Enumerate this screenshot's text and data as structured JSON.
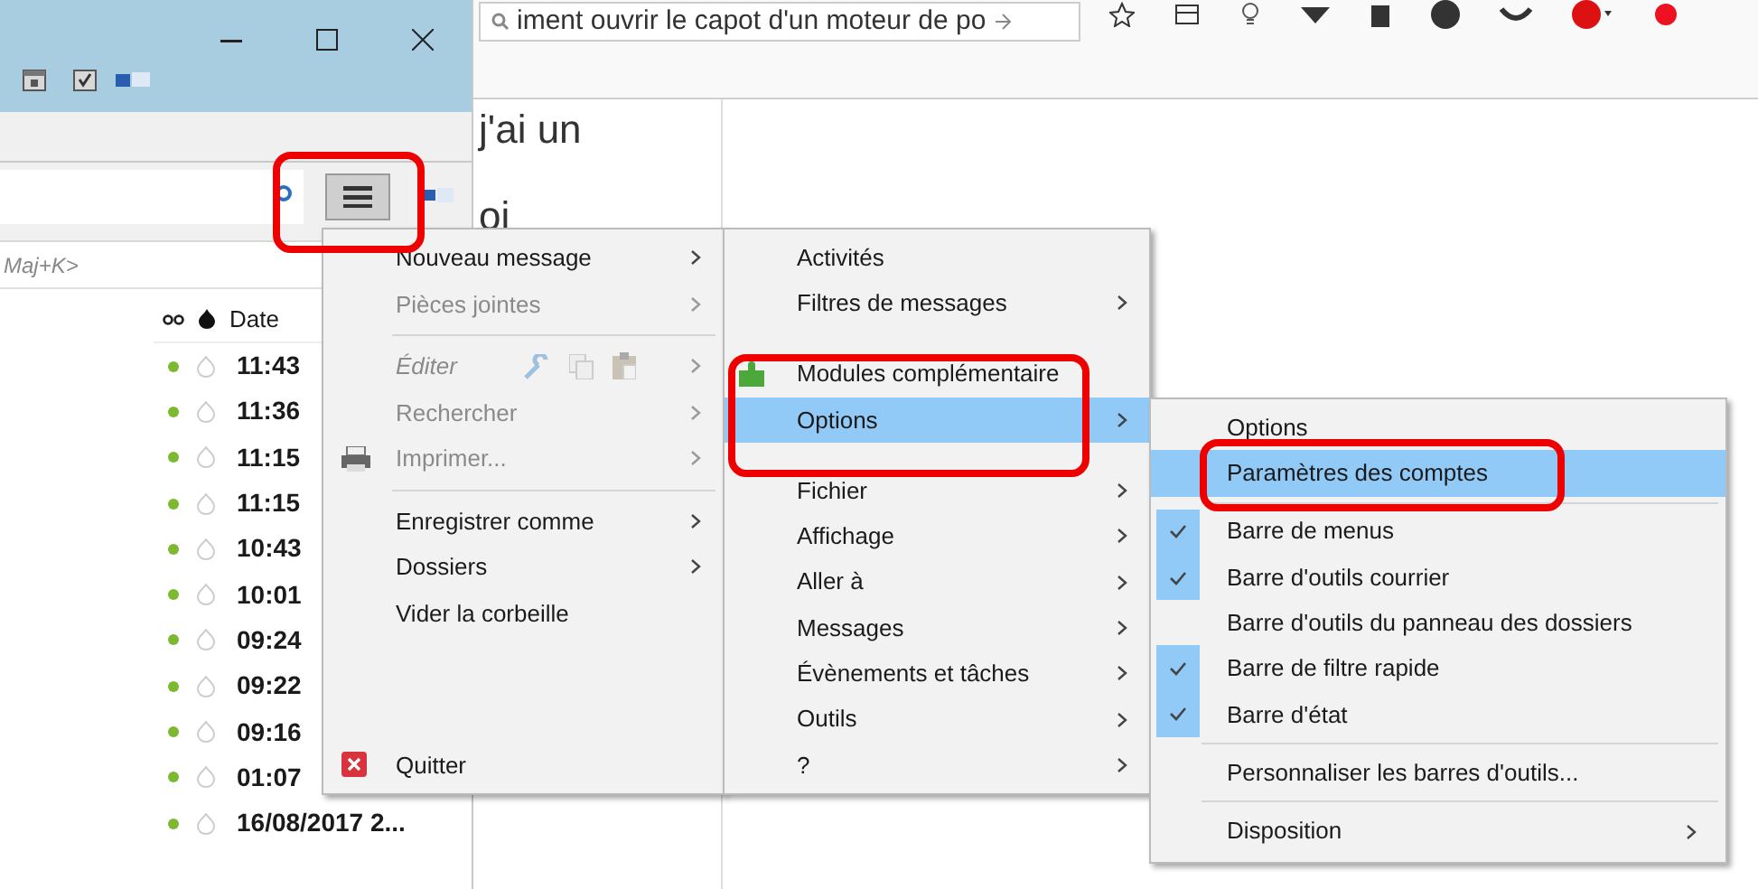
{
  "browser": {
    "address_text": "iment ouvrir le capot d'un moteur de po",
    "page_lines": [
      "j'ai un",
      "oi"
    ]
  },
  "mail_window": {
    "search_placeholder": "Maj+K>",
    "list_header": "Date",
    "rows": [
      {
        "date": "11:43",
        "unread": true
      },
      {
        "date": "11:36",
        "unread": true
      },
      {
        "date": "11:15",
        "unread": true
      },
      {
        "date": "11:15",
        "unread": true
      },
      {
        "date": "10:43",
        "unread": true
      },
      {
        "date": "10:01",
        "unread": true
      },
      {
        "date": "09:24",
        "unread": true
      },
      {
        "date": "09:22",
        "unread": true
      },
      {
        "date": "09:16",
        "unread": true
      },
      {
        "date": "01:07",
        "unread": true
      },
      {
        "date": "16/08/2017 2...",
        "unread": true
      }
    ]
  },
  "app_menu": {
    "items": [
      {
        "kind": "item",
        "label": "Nouveau message",
        "disabled": false,
        "submenu": true
      },
      {
        "kind": "item",
        "label": "Pièces jointes",
        "disabled": true,
        "submenu": true
      },
      {
        "kind": "separator"
      },
      {
        "kind": "edit",
        "label": "Éditer",
        "disabled": true,
        "submenu": true
      },
      {
        "kind": "item",
        "label": "Rechercher",
        "disabled": true,
        "submenu": true
      },
      {
        "kind": "print",
        "label": "Imprimer...",
        "disabled": true,
        "submenu": true
      },
      {
        "kind": "separator"
      },
      {
        "kind": "item",
        "label": "Enregistrer comme",
        "disabled": false,
        "submenu": true
      },
      {
        "kind": "item",
        "label": "Dossiers",
        "disabled": false,
        "submenu": true
      },
      {
        "kind": "item",
        "label": "Vider la corbeille",
        "disabled": false,
        "submenu": false
      },
      {
        "kind": "spacer"
      },
      {
        "kind": "quit",
        "label": "Quitter",
        "disabled": false,
        "submenu": false
      }
    ]
  },
  "menu_bar_menu": {
    "items": [
      {
        "kind": "item",
        "label": "Activités",
        "selected": false,
        "submenu": false
      },
      {
        "kind": "item",
        "label": "Filtres de messages",
        "selected": false,
        "submenu": true
      },
      {
        "kind": "gap"
      },
      {
        "kind": "addons",
        "label": "Modules complémentaire",
        "selected": false,
        "submenu": false
      },
      {
        "kind": "item",
        "label": "Options",
        "selected": true,
        "submenu": true
      },
      {
        "kind": "gap"
      },
      {
        "kind": "item",
        "label": "Fichier",
        "selected": false,
        "submenu": true
      },
      {
        "kind": "item",
        "label": "Affichage",
        "selected": false,
        "submenu": true
      },
      {
        "kind": "item",
        "label": "Aller à",
        "selected": false,
        "submenu": true
      },
      {
        "kind": "item",
        "label": "Messages",
        "selected": false,
        "submenu": true
      },
      {
        "kind": "item",
        "label": "Évènements et tâches",
        "selected": false,
        "submenu": true
      },
      {
        "kind": "item",
        "label": "Outils",
        "selected": false,
        "submenu": true
      },
      {
        "kind": "item",
        "label": "?",
        "selected": false,
        "submenu": true
      }
    ]
  },
  "options_menu": {
    "items": [
      {
        "kind": "item",
        "label": "Options",
        "selected": false,
        "checked": false,
        "submenu": false
      },
      {
        "kind": "item",
        "label": "Paramètres des comptes",
        "selected": true,
        "checked": false,
        "submenu": false
      },
      {
        "kind": "separator"
      },
      {
        "kind": "item",
        "label": "Barre de menus",
        "selected": false,
        "checked": true,
        "submenu": false
      },
      {
        "kind": "item",
        "label": "Barre d'outils courrier",
        "selected": false,
        "checked": true,
        "submenu": false
      },
      {
        "kind": "item",
        "label": "Barre d'outils du panneau des dossiers",
        "selected": false,
        "checked": false,
        "submenu": false
      },
      {
        "kind": "item",
        "label": "Barre de filtre rapide",
        "selected": false,
        "checked": true,
        "submenu": false
      },
      {
        "kind": "item",
        "label": "Barre d'état",
        "selected": false,
        "checked": true,
        "submenu": false
      },
      {
        "kind": "separator"
      },
      {
        "kind": "item",
        "label": "Personnaliser les barres d'outils...",
        "selected": false,
        "checked": false,
        "submenu": false
      },
      {
        "kind": "separator"
      },
      {
        "kind": "item",
        "label": "Disposition",
        "selected": false,
        "checked": false,
        "submenu": true
      }
    ]
  }
}
